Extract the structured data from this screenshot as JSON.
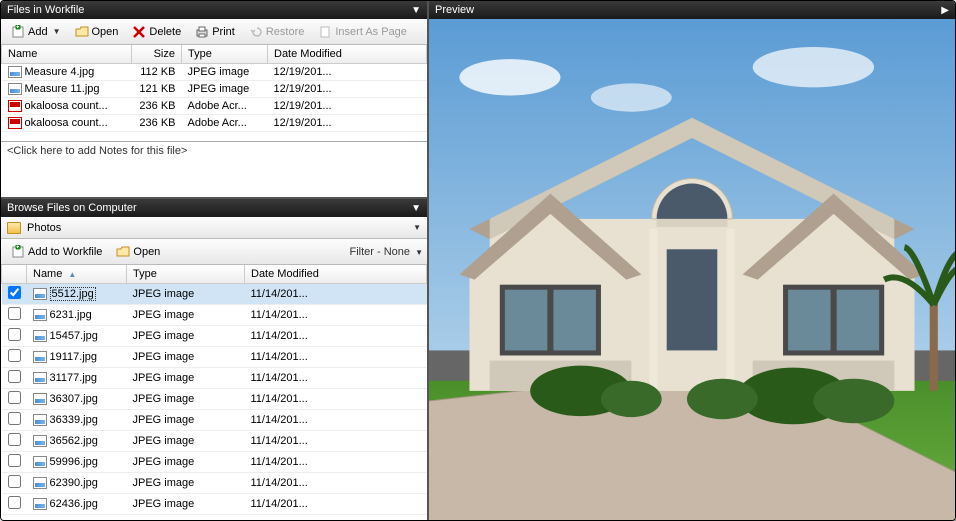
{
  "workfile": {
    "title": "Files in Workfile",
    "toolbar": {
      "add": "Add",
      "open": "Open",
      "delete": "Delete",
      "print": "Print",
      "restore": "Restore",
      "insert": "Insert As Page"
    },
    "columns": {
      "name": "Name",
      "size": "Size",
      "type": "Type",
      "date": "Date Modified"
    },
    "rows": [
      {
        "icon": "img",
        "name": "Measure 4.jpg",
        "size": "112 KB",
        "type": "JPEG image",
        "date": "12/19/201..."
      },
      {
        "icon": "img",
        "name": "Measure 11.jpg",
        "size": "121 KB",
        "type": "JPEG image",
        "date": "12/19/201..."
      },
      {
        "icon": "pdf",
        "name": "okaloosa count...",
        "size": "236 KB",
        "type": "Adobe Acr...",
        "date": "12/19/201..."
      },
      {
        "icon": "pdf",
        "name": "okaloosa count...",
        "size": "236 KB",
        "type": "Adobe Acr...",
        "date": "12/19/201..."
      }
    ],
    "notes_placeholder": "<Click here to add Notes for this file>"
  },
  "browse": {
    "title": "Browse Files on Computer",
    "folder": "Photos",
    "toolbar": {
      "add_workfile": "Add to Workfile",
      "open": "Open",
      "filter": "Filter - None"
    },
    "columns": {
      "name": "Name",
      "type": "Type",
      "date": "Date Modified"
    },
    "rows": [
      {
        "checked": true,
        "name": "5512.jpg",
        "type": "JPEG image",
        "date": "11/14/201...",
        "selected": true
      },
      {
        "checked": false,
        "name": "6231.jpg",
        "type": "JPEG image",
        "date": "11/14/201..."
      },
      {
        "checked": false,
        "name": "15457.jpg",
        "type": "JPEG image",
        "date": "11/14/201..."
      },
      {
        "checked": false,
        "name": "19117.jpg",
        "type": "JPEG image",
        "date": "11/14/201..."
      },
      {
        "checked": false,
        "name": "31177.jpg",
        "type": "JPEG image",
        "date": "11/14/201..."
      },
      {
        "checked": false,
        "name": "36307.jpg",
        "type": "JPEG image",
        "date": "11/14/201..."
      },
      {
        "checked": false,
        "name": "36339.jpg",
        "type": "JPEG image",
        "date": "11/14/201..."
      },
      {
        "checked": false,
        "name": "36562.jpg",
        "type": "JPEG image",
        "date": "11/14/201..."
      },
      {
        "checked": false,
        "name": "59996.jpg",
        "type": "JPEG image",
        "date": "11/14/201..."
      },
      {
        "checked": false,
        "name": "62390.jpg",
        "type": "JPEG image",
        "date": "11/14/201..."
      },
      {
        "checked": false,
        "name": "62436.jpg",
        "type": "JPEG image",
        "date": "11/14/201..."
      }
    ]
  },
  "preview": {
    "title": "Preview"
  }
}
